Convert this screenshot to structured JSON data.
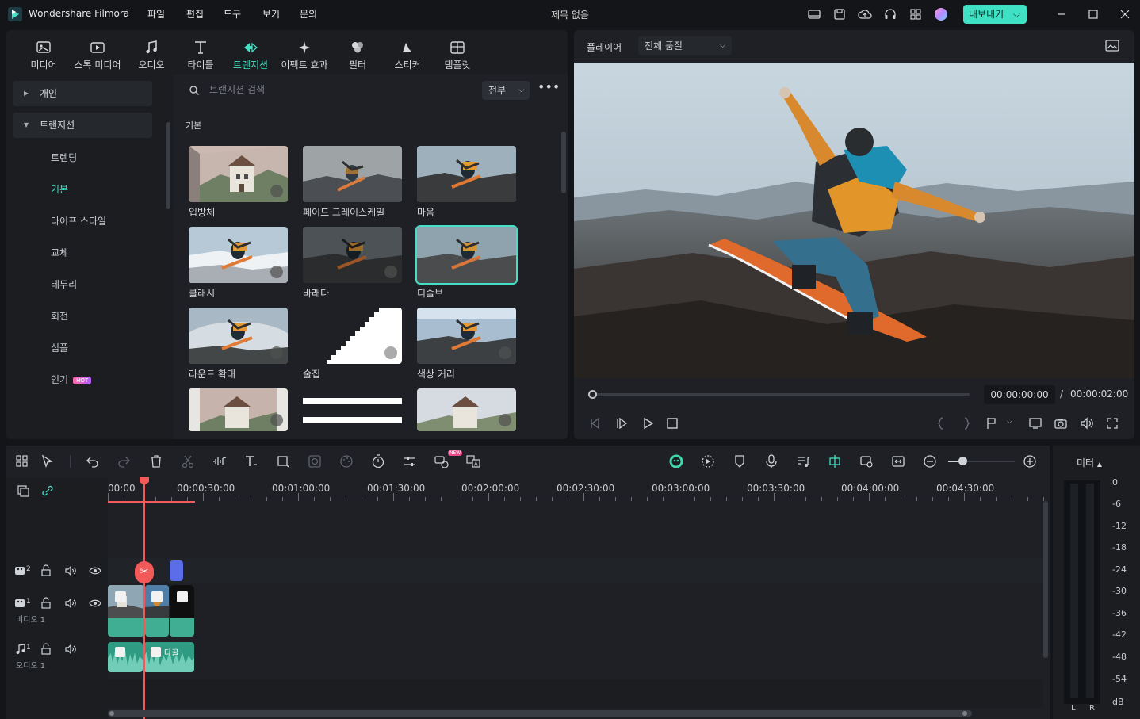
{
  "app": {
    "name": "Wondershare Filmora",
    "doc_title": "제목 없음",
    "export_label": "내보내기"
  },
  "menu": [
    "파일",
    "편집",
    "도구",
    "보기",
    "문의"
  ],
  "media_tabs": [
    {
      "label": "미디어",
      "icon": "media-icon"
    },
    {
      "label": "스톡 미디어",
      "icon": "stock-media-icon"
    },
    {
      "label": "오디오",
      "icon": "audio-icon"
    },
    {
      "label": "타이틀",
      "icon": "title-icon"
    },
    {
      "label": "트랜지션",
      "icon": "transition-icon",
      "active": true
    },
    {
      "label": "이펙트 효과",
      "icon": "effects-icon"
    },
    {
      "label": "필터",
      "icon": "filter-icon"
    },
    {
      "label": "스티커",
      "icon": "sticker-icon"
    },
    {
      "label": "템플릿",
      "icon": "template-icon"
    }
  ],
  "sidebar": {
    "groups": [
      "개인",
      "트랜지션"
    ],
    "items": [
      "트렌딩",
      "기본",
      "라이프 스타일",
      "교체",
      "테두리",
      "회전",
      "심플",
      "인기"
    ],
    "active_item": "기본",
    "hot_badge": "HOT"
  },
  "search": {
    "placeholder": "트랜지션 검색",
    "filter": "전부",
    "more": "•••"
  },
  "section": "기본",
  "transitions": [
    "입방체",
    "페이드 그레이스케일",
    "마음",
    "클래시",
    "바래다",
    "디졸브",
    "라운드 확대",
    "술집",
    "색상 거리"
  ],
  "player": {
    "label": "플레이어",
    "quality": "전체 품질",
    "current_time": "00:00:00:00",
    "separator": "/",
    "total_time": "00:00:02:00",
    "progress": 0
  },
  "timeline": {
    "ruler": [
      "00:00",
      "00:00:30:00",
      "00:01:00:00",
      "00:01:30:00",
      "00:02:00:00",
      "00:02:30:00",
      "00:03:00:00",
      "00:03:30:00",
      "00:04:00:00",
      "00:04:30:00"
    ],
    "tracks": [
      {
        "num": "2",
        "name": ""
      },
      {
        "num": "1",
        "name": "비디오 1"
      },
      {
        "num": "1",
        "name": "오디오 1"
      }
    ],
    "new_badge": "NEW",
    "audio_clip_label": "다꿀"
  },
  "meter": {
    "title": "미터",
    "scale": [
      "0",
      "-6",
      "-12",
      "-18",
      "-24",
      "-30",
      "-36",
      "-42",
      "-48",
      "-54",
      "dB"
    ],
    "channels": [
      "L",
      "R"
    ]
  },
  "colors": {
    "accent": "#44e0c5",
    "playhead": "#f25a5a",
    "clip": "#3fae93"
  }
}
